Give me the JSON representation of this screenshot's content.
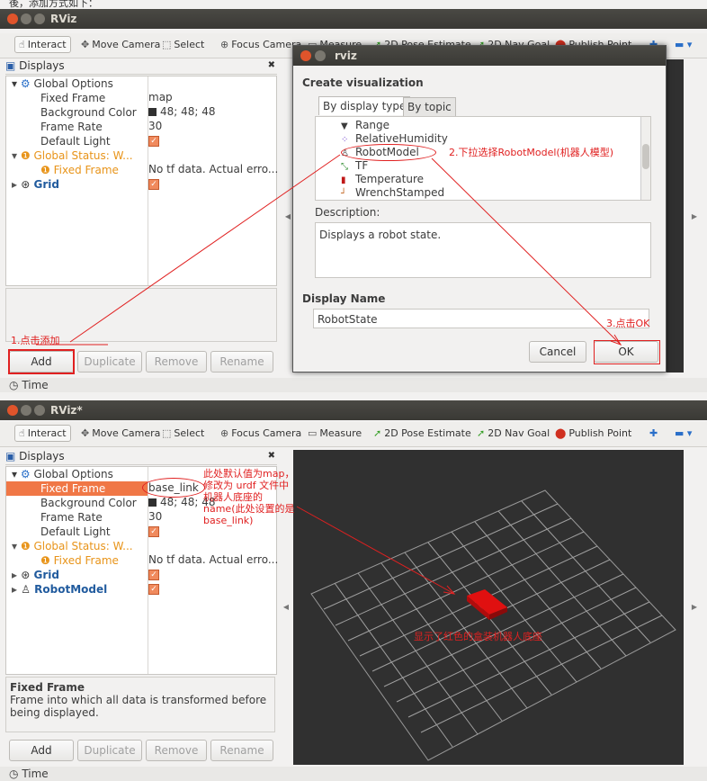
{
  "caption": "後，添加方式如下：",
  "top": {
    "window_title": "RViz",
    "toolbar": [
      "Interact",
      "Move Camera",
      "Select",
      "Focus Camera",
      "Measure",
      "2D Pose Estimate",
      "2D Nav Goal",
      "Publish Point"
    ],
    "displays_title": "Displays",
    "tree": {
      "global_options": "Global Options",
      "fixed_frame_label": "Fixed Frame",
      "fixed_frame_value": "map",
      "bg_label": "Background Color",
      "bg_value": "48; 48; 48",
      "framerate_label": "Frame Rate",
      "framerate_value": "30",
      "light_label": "Default Light",
      "status_label": "Global Status: W...",
      "status_ff_label": "Fixed Frame",
      "status_ff_value": "No tf data.  Actual erro...",
      "grid_label": "Grid"
    },
    "buttons": {
      "add": "Add",
      "duplicate": "Duplicate",
      "remove": "Remove",
      "rename": "Rename"
    },
    "time": "Time",
    "annotation_add": "1.点击添加"
  },
  "dialog": {
    "title": "rviz",
    "heading": "Create visualization",
    "tab_type": "By display type",
    "tab_topic": "By topic",
    "items": [
      "Range",
      "RelativeHumidity",
      "RobotModel",
      "TF",
      "Temperature",
      "WrenchStamped"
    ],
    "description_label": "Description:",
    "description": "Displays a robot state.",
    "display_name_label": "Display Name",
    "display_name_value": "RobotState",
    "cancel": "Cancel",
    "ok": "OK",
    "annotation_select": "2.下拉选择RobotModel(机器人模型)",
    "annotation_ok": "3.点击OK"
  },
  "bottom": {
    "window_title": "RViz*",
    "toolbar": [
      "Interact",
      "Move Camera",
      "Select",
      "Focus Camera",
      "Measure",
      "2D Pose Estimate",
      "2D Nav Goal",
      "Publish Point"
    ],
    "displays_title": "Displays",
    "tree": {
      "global_options": "Global Options",
      "fixed_frame_label": "Fixed Frame",
      "fixed_frame_value": "base_link",
      "bg_label": "Background Color",
      "bg_value": "48; 48; 48",
      "framerate_label": "Frame Rate",
      "framerate_value": "30",
      "light_label": "Default Light",
      "status_label": "Global Status: W...",
      "status_ff_label": "Fixed Frame",
      "status_ff_value": "No tf data.  Actual erro...",
      "grid_label": "Grid",
      "robotmodel_label": "RobotModel"
    },
    "help_title": "Fixed Frame",
    "help_text": "Frame into which all data is transformed before being displayed.",
    "buttons": {
      "add": "Add",
      "duplicate": "Duplicate",
      "remove": "Remove",
      "rename": "Rename"
    },
    "time": "Time",
    "annotation_fixed_frame": "此处默认值为map，修改为 urdf 文件中机器人底座的 name(此处设置的是 base_link)",
    "annotation_robot": "显示了红色的盒装机器人底座"
  }
}
